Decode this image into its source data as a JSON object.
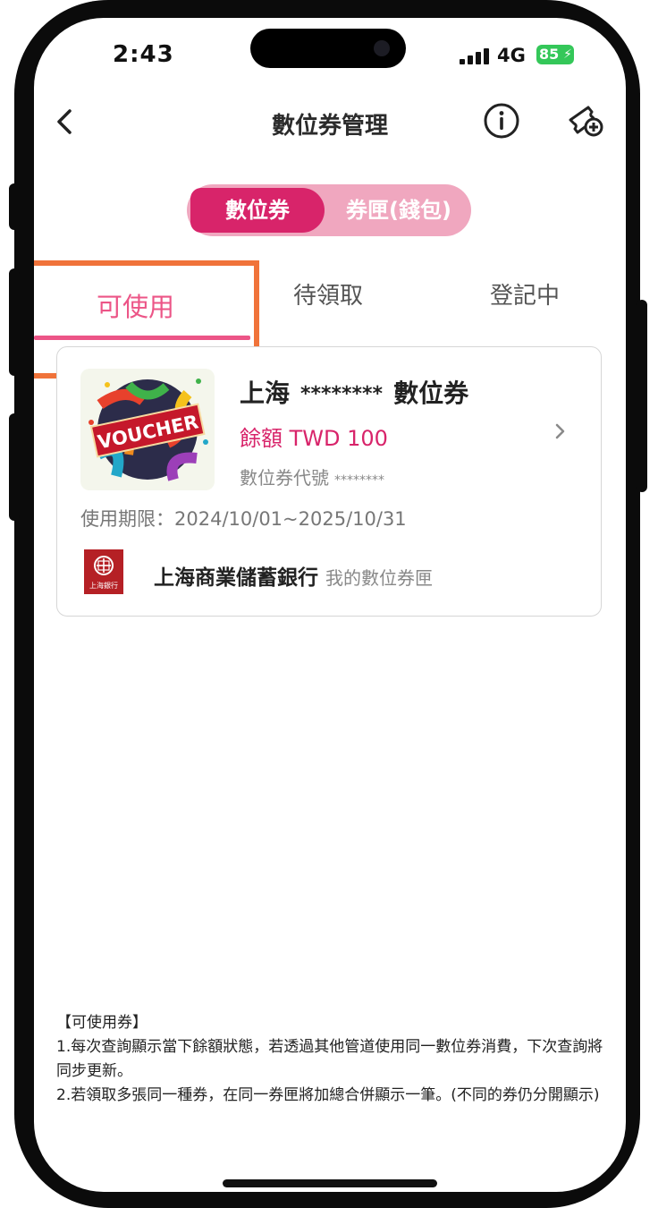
{
  "status_bar": {
    "time": "2:43",
    "network": "4G",
    "battery": "85"
  },
  "header": {
    "title": "數位券管理"
  },
  "segment": {
    "active_label": "數位券",
    "inactive_label": "券匣(錢包)"
  },
  "tabs": [
    {
      "label": "可使用",
      "active": true
    },
    {
      "label": "待領取",
      "active": false
    },
    {
      "label": "登記中",
      "active": false
    }
  ],
  "voucher": {
    "name_prefix": "上海",
    "name_mask": "********",
    "name_suffix": "數位券",
    "balance": "餘額 TWD 100",
    "code_label": "數位券代號",
    "code_mask": "********",
    "validity": "使用期限：2024/10/01~2025/10/31",
    "bank_name": "上海商業儲蓄銀行",
    "wallet": "我的數位券匣",
    "image_text": "VOUCHER",
    "bank_logo_text": "上海銀行"
  },
  "notes": {
    "title": "【可使用券】",
    "line1": "1.每次查詢顯示當下餘額狀態，若透過其他管道使用同一數位券消費，下次查詢將同步更新。",
    "line2": "2.若領取多張同一種券，在同一券匣將加總合併顯示一筆。(不同的券仍分開顯示)"
  },
  "colors": {
    "accent": "#d8246a",
    "tab_active": "#ec5587",
    "segment_bg": "#f0a7bf",
    "highlight": "#f0733a",
    "bank_red": "#b52025"
  }
}
